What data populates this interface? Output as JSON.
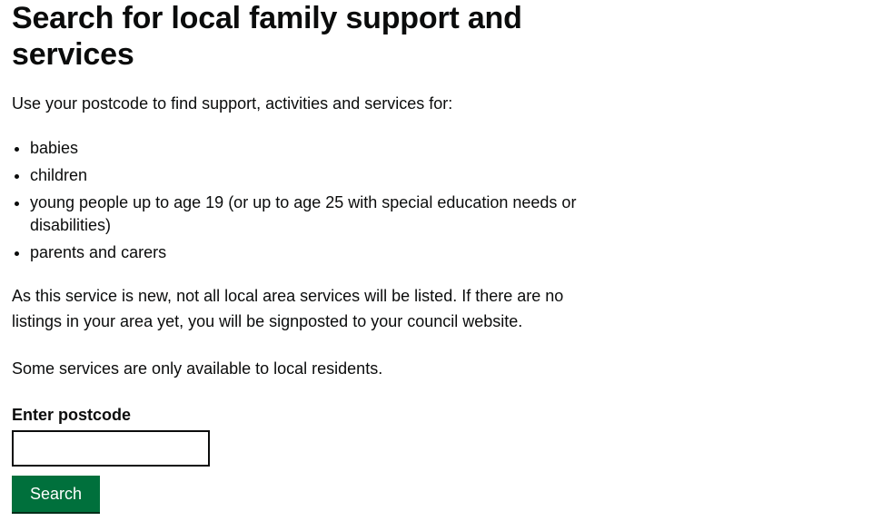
{
  "page": {
    "title": "Search for local family support and services",
    "intro": "Use your postcode to find support, activities and services for:",
    "audience": [
      "babies",
      "children",
      "young people up to age 19 (or up to age 25 with special education needs or disabilities)",
      "parents and carers"
    ],
    "notice": "As this service is new, not all local area services will be listed. If there are no listings in your area yet, you will be signposted to your council website.",
    "residents_note": "Some services are only available to local residents."
  },
  "form": {
    "postcode_label": "Enter postcode",
    "postcode_value": "",
    "postcode_placeholder": "",
    "search_button_label": "Search"
  },
  "colors": {
    "text": "#0b0c0c",
    "button_green": "#00703c",
    "button_shadow": "#002d18",
    "background": "#ffffff"
  }
}
